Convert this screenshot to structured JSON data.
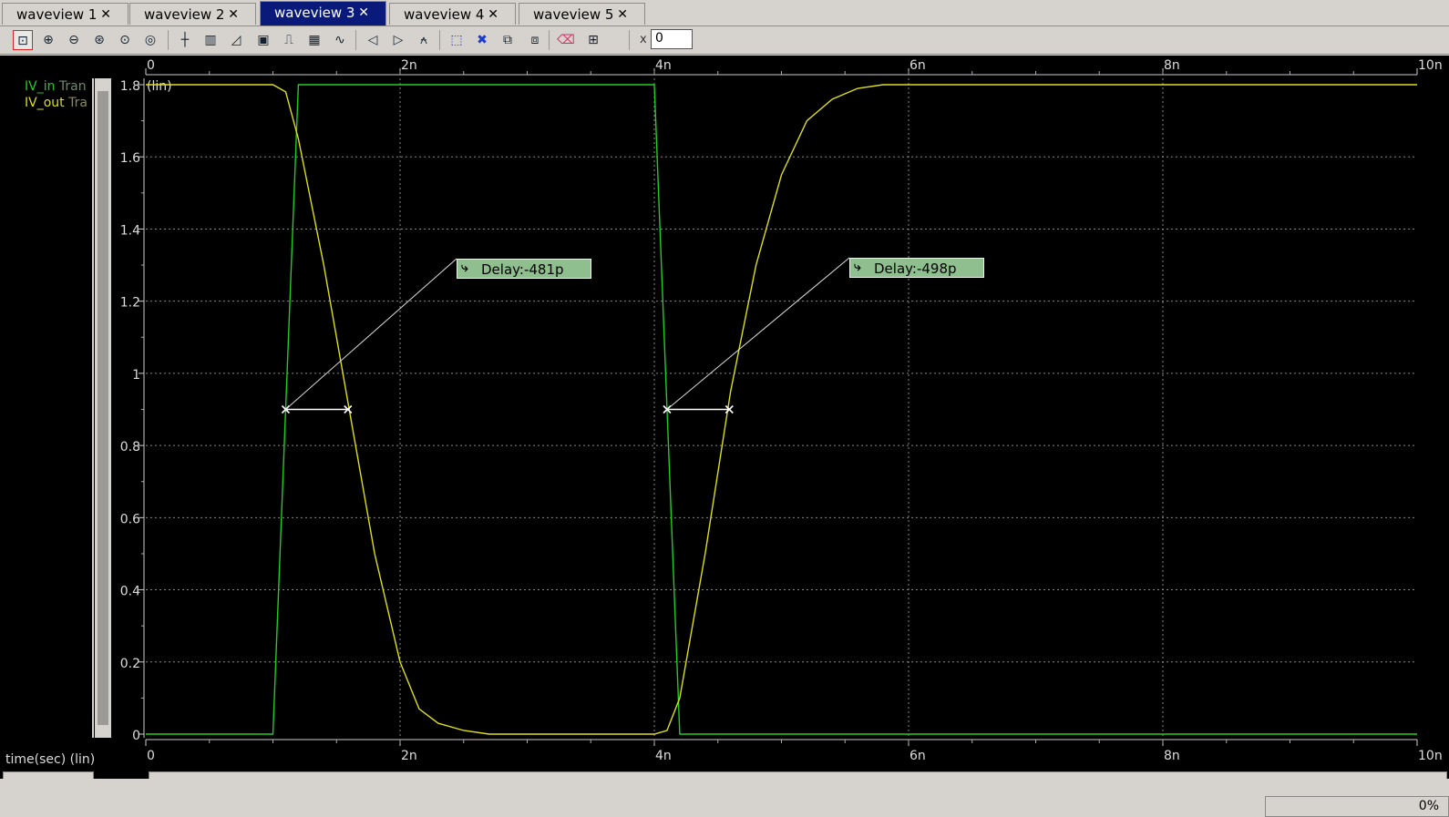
{
  "tabs": [
    {
      "label": "waveview 1",
      "active": false
    },
    {
      "label": "waveview 2",
      "active": false
    },
    {
      "label": "waveview 3",
      "active": true
    },
    {
      "label": "waveview 4",
      "active": false
    },
    {
      "label": "waveview 5",
      "active": false
    }
  ],
  "tab_close_glyph": "✕",
  "toolbar": {
    "icons": [
      "zoom-fit-icon",
      "zoom-in-icon",
      "zoom-out-icon",
      "zoom-box-icon",
      "zoom-x-icon",
      "zoom-y-icon",
      "crosshair-icon",
      "bars-icon",
      "ruler-icon",
      "label-icon",
      "pulse-icon",
      "grid-icon",
      "wave-icon",
      "prev-icon",
      "next-icon",
      "delay-measure-icon",
      "select-icon",
      "delete-icon",
      "copy-icon",
      "paste-icon",
      "eraser-icon",
      "layout-icon"
    ],
    "x_label": "x",
    "x_value": "0"
  },
  "legend": [
    {
      "signal": "IV_in",
      "suffix": "Tran",
      "color": "#22cc22"
    },
    {
      "signal": "IV_out",
      "suffix": "Tra",
      "color": "#dddd22"
    }
  ],
  "markers": [
    {
      "label": "Delay:-481p"
    },
    {
      "label": "Delay:-498p"
    }
  ],
  "status": {
    "percent": "0%"
  },
  "chart_data": {
    "type": "line",
    "xlabel": "time(sec) (lin)",
    "ylabel_unit": "(lin)",
    "x_ticks": [
      "0",
      "2n",
      "4n",
      "6n",
      "8n",
      "10n"
    ],
    "y_ticks": [
      "0",
      "0.2",
      "0.4",
      "0.6",
      "0.8",
      "1",
      "1.2",
      "1.4",
      "1.6",
      "1.8"
    ],
    "xlim_ns": [
      0,
      10
    ],
    "ylim": [
      0,
      1.8
    ],
    "grid": true,
    "series": [
      {
        "name": "IV_in",
        "color": "#22cc22",
        "x": [
          0,
          1.0,
          1.2,
          4.0,
          4.2,
          10.0
        ],
        "y": [
          0,
          0,
          1.8,
          1.8,
          0,
          0
        ]
      },
      {
        "name": "IV_out",
        "color": "#dddd22",
        "x": [
          0,
          1.0,
          1.1,
          1.2,
          1.4,
          1.6,
          1.8,
          2.0,
          2.15,
          2.3,
          2.5,
          2.7,
          3.0,
          4.0,
          4.1,
          4.2,
          4.4,
          4.6,
          4.8,
          5.0,
          5.2,
          5.4,
          5.6,
          5.8,
          6.0,
          6.5,
          7.0,
          10.0
        ],
        "y": [
          1.8,
          1.8,
          1.78,
          1.65,
          1.3,
          0.9,
          0.5,
          0.2,
          0.07,
          0.03,
          0.01,
          0.0,
          0.0,
          0.0,
          0.01,
          0.1,
          0.5,
          0.95,
          1.3,
          1.55,
          1.7,
          1.76,
          1.79,
          1.8,
          1.8,
          1.8,
          1.8,
          1.8
        ]
      }
    ],
    "delay_measurements": [
      {
        "label": "Delay:-481p",
        "t_start": 1.1,
        "t_end": 1.59,
        "level": 0.9
      },
      {
        "label": "Delay:-498p",
        "t_start": 4.1,
        "t_end": 4.59,
        "level": 0.9
      }
    ]
  }
}
